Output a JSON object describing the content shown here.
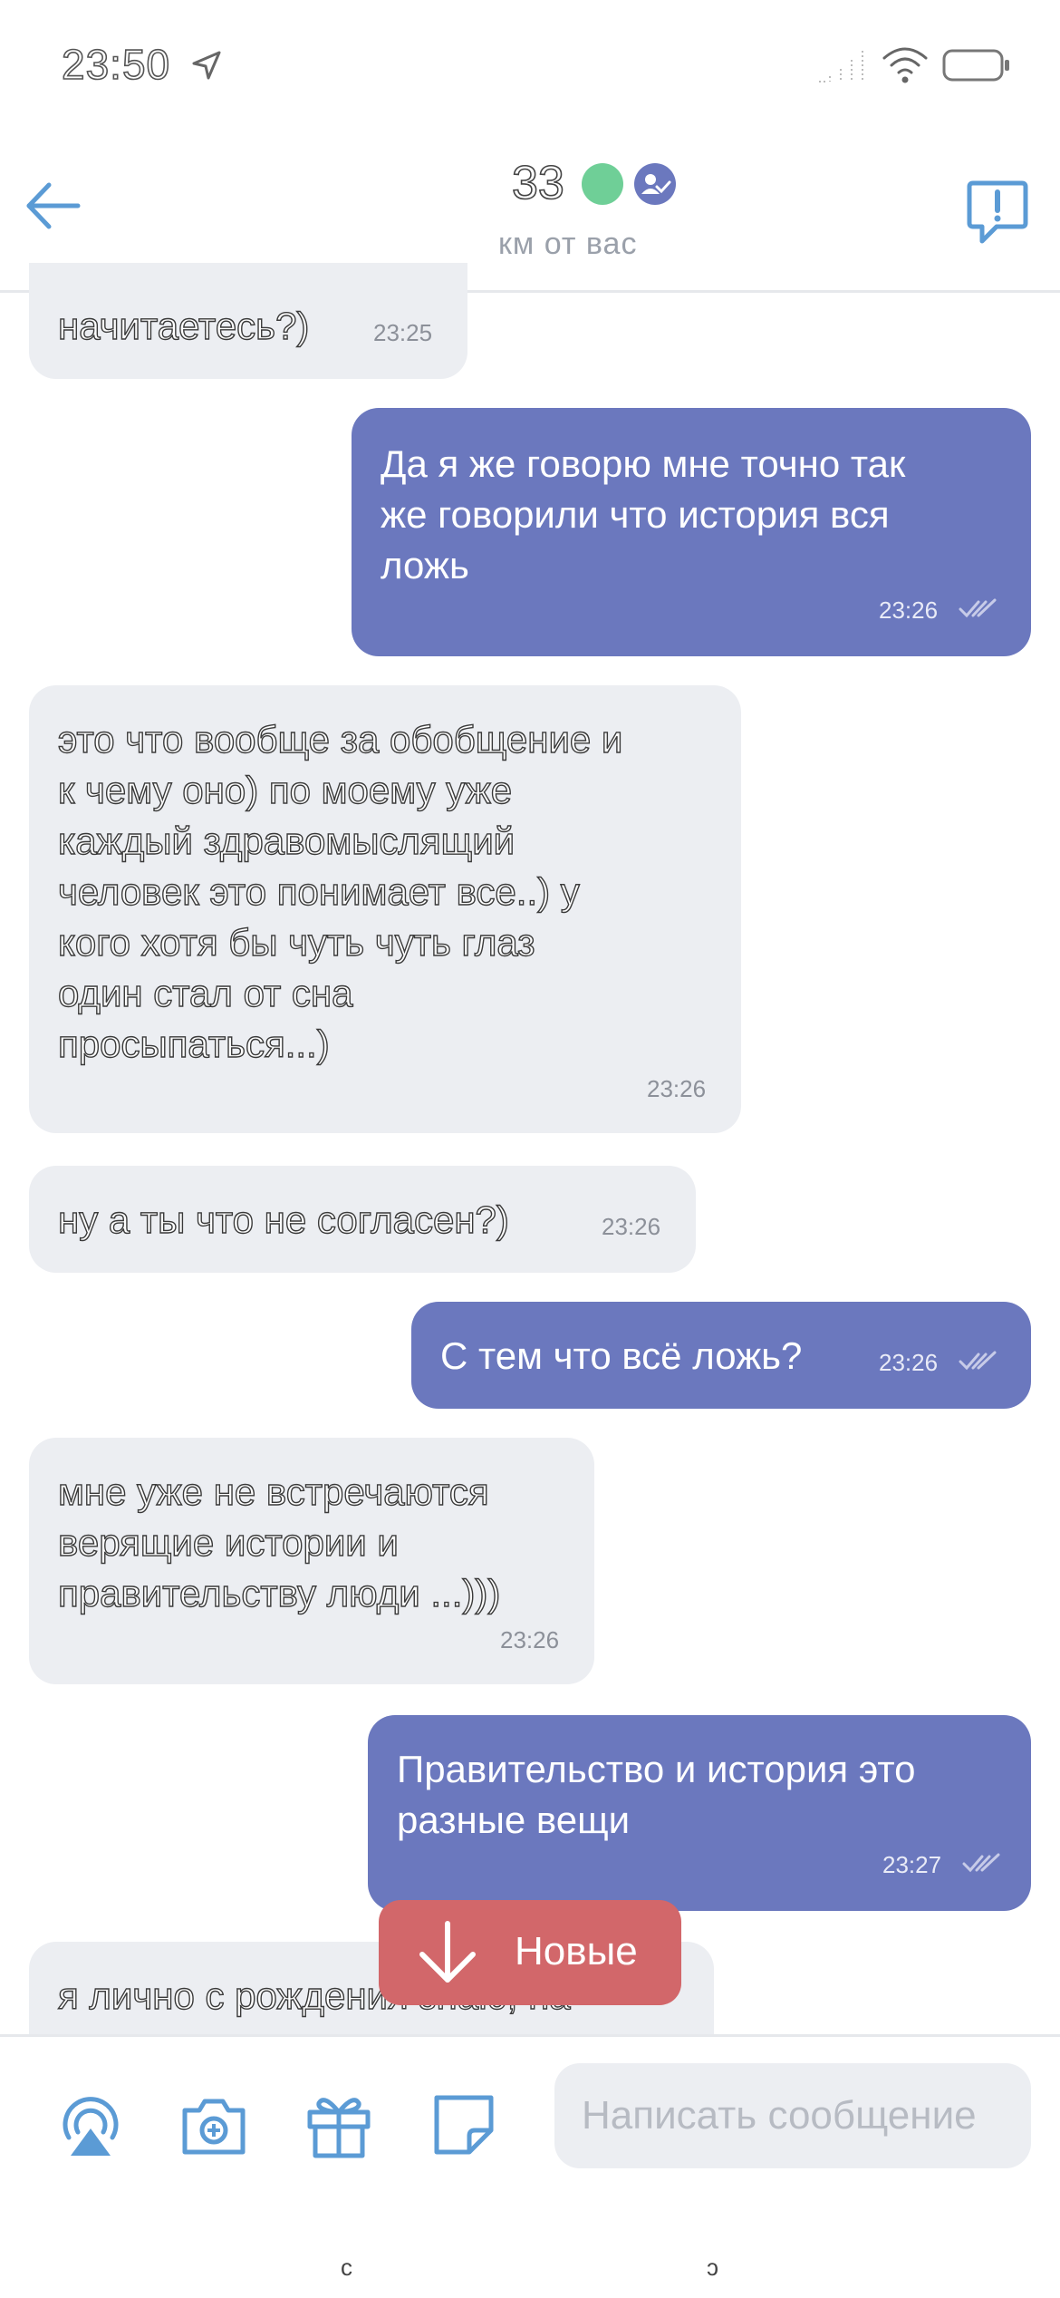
{
  "status_bar": {
    "time": "23:50"
  },
  "header": {
    "title": "33",
    "subtitle": "км от вас"
  },
  "messages": [
    {
      "dir": "in",
      "text": "начитаетесь?)",
      "time": "23:25"
    },
    {
      "dir": "out",
      "lines": [
        "Да я же говорю мне точно так",
        "же говорили что история вся",
        "ложь"
      ],
      "time": "23:26"
    },
    {
      "dir": "in",
      "lines": [
        "это что вообще за обобщение и",
        "к чему оно) по моему уже",
        "каждый здравомыслящий",
        "человек это понимает все..) у",
        "кого хотя бы чуть чуть глаз",
        "один стал от сна",
        "просыпаться...)"
      ],
      "time": "23:26"
    },
    {
      "dir": "in",
      "text": "ну а ты что не согласен?)",
      "time": "23:26"
    },
    {
      "dir": "out",
      "text": "С тем что всё ложь?",
      "time": "23:26"
    },
    {
      "dir": "in",
      "lines": [
        "мне уже не встречаются",
        "верящие истории и",
        "правительству люди ...)))"
      ],
      "time": "23:26"
    },
    {
      "dir": "out",
      "lines": [
        "Правительство и история это",
        "разные вещи"
      ],
      "time": "23:27"
    },
    {
      "dir": "in",
      "text": "я лично с рождения знаю, на"
    }
  ],
  "new_button": {
    "label": "Новые"
  },
  "composer": {
    "placeholder": "Написать сообщение"
  },
  "colors": {
    "accent": "#5b9bd5",
    "outgoing": "#6b78be",
    "incoming": "#eceef2",
    "new_button": "#d2676a",
    "online": "#6fcf97"
  },
  "icons": [
    "location-arrow-icon",
    "signal-icon",
    "wifi-icon",
    "battery-icon",
    "back-arrow-icon",
    "verified-icon",
    "report-icon",
    "arrow-down-icon",
    "stream-icon",
    "camera-icon",
    "gift-icon",
    "sticker-icon"
  ]
}
